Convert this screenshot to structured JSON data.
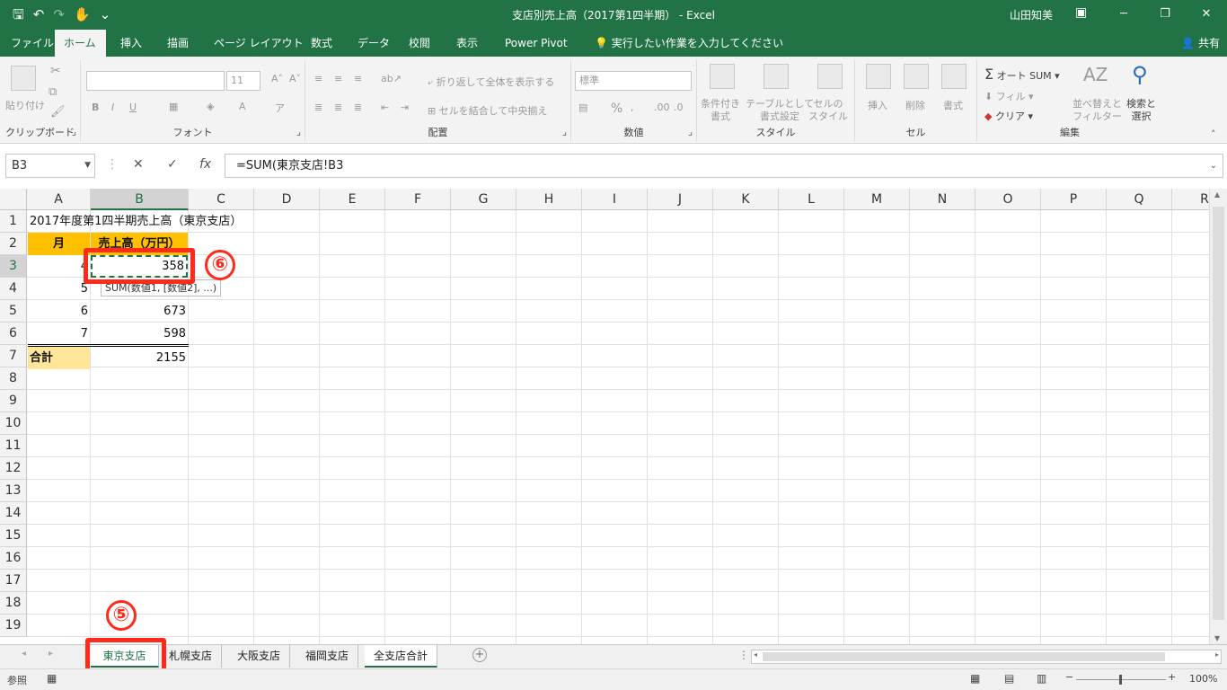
{
  "window": {
    "title": "支店別売上高（2017第1四半期） - Excel",
    "user": "山田知美",
    "minimize": "─",
    "maximize": "❐",
    "close": "✕",
    "ribbon_options": "▣"
  },
  "qat": {
    "save_icon": "🖫",
    "undo_icon": "↶",
    "redo_icon": "↷",
    "touch_icon": "✋",
    "customize_icon": "⌄"
  },
  "tabs": [
    {
      "label": "ファイル"
    },
    {
      "label": "ホーム"
    },
    {
      "label": "挿入"
    },
    {
      "label": "描画"
    },
    {
      "label": "ページ レイアウト"
    },
    {
      "label": "数式"
    },
    {
      "label": "データ"
    },
    {
      "label": "校閲"
    },
    {
      "label": "表示"
    },
    {
      "label": "Power Pivot"
    },
    {
      "label": "実行したい作業を入力してください"
    }
  ],
  "share_label": "共有",
  "ribbon": {
    "clipboard": {
      "label": "クリップボード",
      "paste": "貼り付け"
    },
    "font": {
      "label": "フォント",
      "font_size": "11",
      "bold": "B",
      "italic": "I",
      "underline": "U"
    },
    "alignment": {
      "label": "配置",
      "wrap": "折り返して全体を表示する",
      "merge": "セルを結合して中央揃え"
    },
    "number": {
      "label": "数値",
      "format": "標準",
      "percent": "%"
    },
    "styles": {
      "label": "スタイル",
      "conditional": "条件付き\n書式",
      "table": "テーブルとして\n書式設定",
      "cell_style": "セルの\nスタイル"
    },
    "cells": {
      "label": "セル",
      "insert": "挿入",
      "delete": "削除",
      "format": "書式"
    },
    "editing": {
      "label": "編集",
      "autosum": "オート SUM",
      "fill": "フィル",
      "clear": "クリア",
      "sort": "並べ替えと\nフィルター",
      "find": "検索と\n選択"
    }
  },
  "formula_bar": {
    "name_box": "B3",
    "cancel": "✕",
    "enter": "✓",
    "fx": "fx",
    "formula": "=SUM(東京支店!B3"
  },
  "columns": [
    "A",
    "B",
    "C",
    "D",
    "E",
    "F",
    "G",
    "H",
    "I",
    "J",
    "K",
    "L",
    "M",
    "N",
    "O",
    "P",
    "Q",
    "R"
  ],
  "rows": [
    "1",
    "2",
    "3",
    "4",
    "5",
    "6",
    "7",
    "8",
    "9",
    "10",
    "11",
    "12",
    "13",
    "14",
    "15",
    "16",
    "17",
    "18",
    "19"
  ],
  "sheet": {
    "title": "2017年度第1四半期売上高（東京支店）",
    "header_month": "月",
    "header_sales": "売上高（万円）",
    "data": [
      {
        "month": "4",
        "sales": "358"
      },
      {
        "month": "5",
        "sales": ""
      },
      {
        "month": "6",
        "sales": "673"
      },
      {
        "month": "7",
        "sales": "598"
      }
    ],
    "total_label": "合計",
    "total_value": "2155",
    "tooltip": "SUM(数値1, [数値2], ...)"
  },
  "sheet_tabs": [
    {
      "label": "東京支店"
    },
    {
      "label": "札幌支店"
    },
    {
      "label": "大阪支店"
    },
    {
      "label": "福岡支店"
    },
    {
      "label": "全支店合計"
    }
  ],
  "status": {
    "mode": "参照",
    "zoom": "100%"
  },
  "callouts": {
    "step5": "⑤",
    "step6": "⑥"
  },
  "colors": {
    "excel_green": "#217346",
    "header_fill": "#ffc000",
    "total_fill": "#ffe699",
    "callout_red": "#ff2a1a"
  }
}
